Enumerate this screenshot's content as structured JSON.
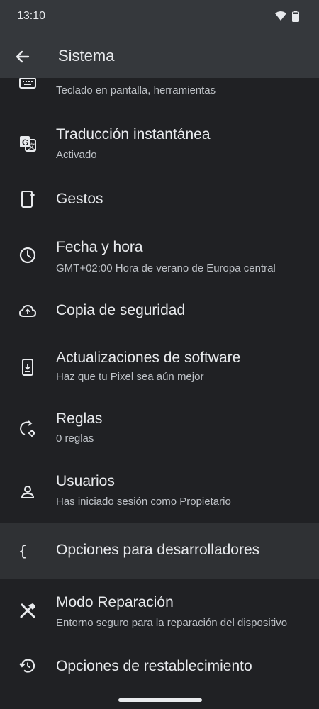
{
  "status": {
    "time": "13:10"
  },
  "appbar": {
    "title": "Sistema"
  },
  "items": [
    {
      "title": "",
      "summary": "Teclado en pantalla, herramientas",
      "icon": "keyboard-icon"
    },
    {
      "title": "Traducción instantánea",
      "summary": "Activado",
      "icon": "translate-icon"
    },
    {
      "title": "Gestos",
      "summary": "",
      "icon": "gestures-phone-icon"
    },
    {
      "title": "Fecha y hora",
      "summary": "GMT+02:00 Hora de verano de Europa central",
      "icon": "clock-icon"
    },
    {
      "title": "Copia de seguridad",
      "summary": "",
      "icon": "cloud-upload-icon"
    },
    {
      "title": "Actualizaciones de software",
      "summary": "Haz que tu Pixel sea aún mejor",
      "icon": "system-update-icon"
    },
    {
      "title": "Reglas",
      "summary": "0 reglas",
      "icon": "rules-icon"
    },
    {
      "title": "Usuarios",
      "summary": "Has iniciado sesión como Propietario",
      "icon": "person-icon"
    },
    {
      "title": "Opciones para desarrolladores",
      "summary": "",
      "icon": "code-braces-icon"
    },
    {
      "title": "Modo Reparación",
      "summary": "Entorno seguro para la reparación del dispositivo",
      "icon": "repair-tools-icon"
    },
    {
      "title": "Opciones de restablecimiento",
      "summary": "",
      "icon": "restore-icon"
    }
  ]
}
